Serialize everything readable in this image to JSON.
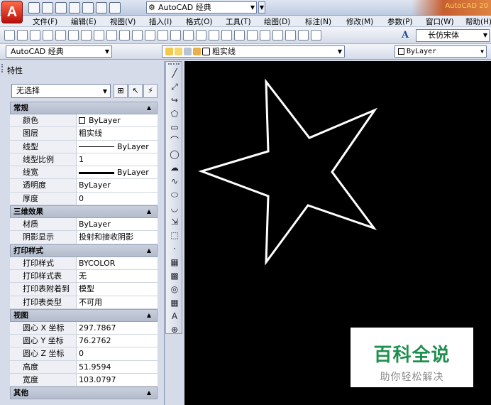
{
  "title_bar": {
    "workspace": "AutoCAD 经典",
    "title_fragment": "AutoCAD 20"
  },
  "menu": [
    "文件(F)",
    "编辑(E)",
    "视图(V)",
    "插入(I)",
    "格式(O)",
    "工具(T)",
    "绘图(D)",
    "标注(N)",
    "修改(M)",
    "参数(P)",
    "窗口(W)",
    "帮助(H)"
  ],
  "toolbar": {
    "text_style": "长仿宋体"
  },
  "toolbar2": {
    "workspace": "AutoCAD 经典",
    "layer": "粗实线",
    "color": "ByLayer"
  },
  "palette": {
    "title": "特性",
    "selection": "无选择",
    "sections": [
      {
        "title": "常规",
        "rows": [
          {
            "name": "颜色",
            "value": "ByLayer",
            "kind": "color"
          },
          {
            "name": "图层",
            "value": "粗实线",
            "kind": "text"
          },
          {
            "name": "线型",
            "value": "ByLayer",
            "kind": "line"
          },
          {
            "name": "线型比例",
            "value": "1",
            "kind": "text"
          },
          {
            "name": "线宽",
            "value": "ByLayer",
            "kind": "thick"
          },
          {
            "name": "透明度",
            "value": "ByLayer",
            "kind": "text"
          },
          {
            "name": "厚度",
            "value": "0",
            "kind": "text"
          }
        ]
      },
      {
        "title": "三维效果",
        "rows": [
          {
            "name": "材质",
            "value": "ByLayer",
            "kind": "text"
          },
          {
            "name": "阴影显示",
            "value": "投射和接收阴影",
            "kind": "text"
          }
        ]
      },
      {
        "title": "打印样式",
        "rows": [
          {
            "name": "打印样式",
            "value": "BYCOLOR",
            "kind": "text"
          },
          {
            "name": "打印样式表",
            "value": "无",
            "kind": "text"
          },
          {
            "name": "打印表附着到",
            "value": "模型",
            "kind": "text"
          },
          {
            "name": "打印表类型",
            "value": "不可用",
            "kind": "text"
          }
        ]
      },
      {
        "title": "视图",
        "rows": [
          {
            "name": "圆心 X 坐标",
            "value": "297.7867",
            "kind": "text"
          },
          {
            "name": "圆心 Y 坐标",
            "value": "76.2762",
            "kind": "text"
          },
          {
            "name": "圆心 Z 坐标",
            "value": "0",
            "kind": "text"
          },
          {
            "name": "高度",
            "value": "51.9594",
            "kind": "text"
          },
          {
            "name": "宽度",
            "value": "103.0797",
            "kind": "text"
          }
        ]
      },
      {
        "title": "其他",
        "rows": []
      }
    ]
  },
  "draw_tools": [
    "line-icon",
    "construction-line-icon",
    "polyline-icon",
    "polygon-icon",
    "rectangle-icon",
    "arc-icon",
    "circle-icon",
    "revision-cloud-icon",
    "spline-icon",
    "ellipse-icon",
    "ellipse-arc-icon",
    "insert-block-icon",
    "make-block-icon",
    "point-icon",
    "hatch-icon",
    "gradient-icon",
    "region-icon",
    "table-icon",
    "multiline-text-icon",
    "add-selected-icon"
  ],
  "watermark": {
    "title": "百科全说",
    "subtitle": "助你轻松解决"
  },
  "colors": {
    "canvas": "#000000",
    "star": "#ffffff",
    "watermark_green": "#1f8f4f"
  }
}
